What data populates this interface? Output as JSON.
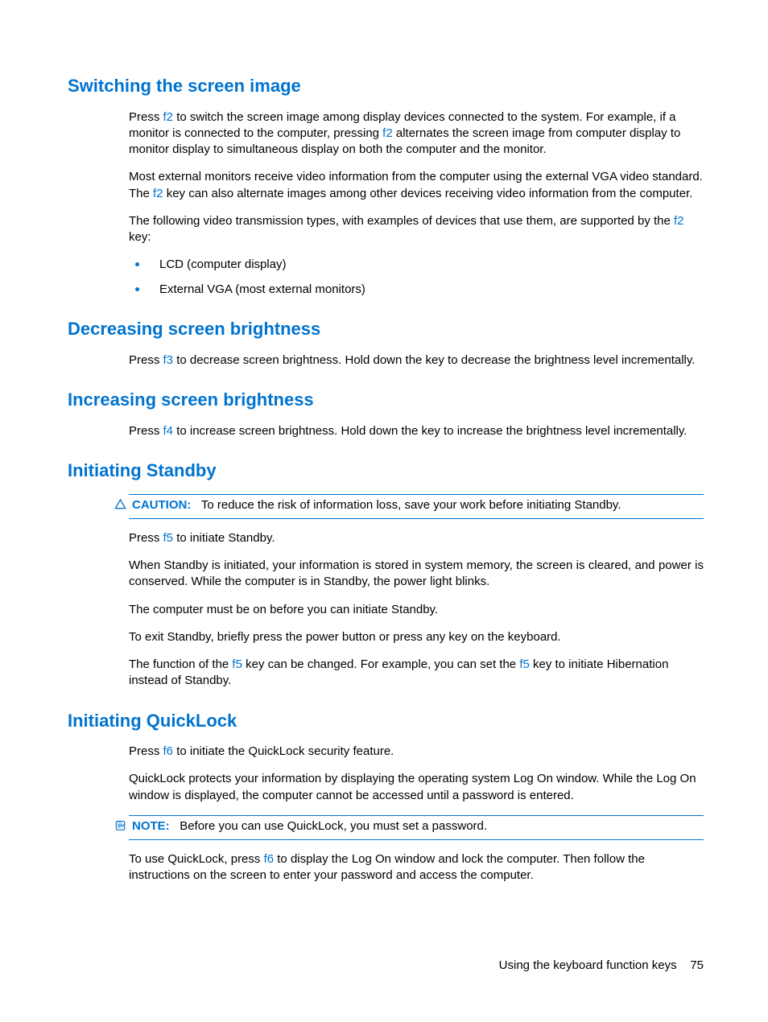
{
  "sections": {
    "s1": {
      "heading": "Switching the screen image",
      "p1a": "Press ",
      "p1key1": "f2",
      "p1b": " to switch the screen image among display devices connected to the system. For example, if a monitor is connected to the computer, pressing ",
      "p1key2": "f2",
      "p1c": " alternates the screen image from computer display to monitor display to simultaneous display on both the computer and the monitor.",
      "p2a": "Most external monitors receive video information from the computer using the external VGA video standard. The ",
      "p2key1": "f2",
      "p2b": " key can also alternate images among other devices receiving video information from the computer.",
      "p3a": "The following video transmission types, with examples of devices that use them, are supported by the ",
      "p3key1": "f2",
      "p3b": " key:",
      "li1": "LCD (computer display)",
      "li2": "External VGA (most external monitors)"
    },
    "s2": {
      "heading": "Decreasing screen brightness",
      "p1a": "Press ",
      "p1key1": "f3",
      "p1b": " to decrease screen brightness. Hold down the key to decrease the brightness level incrementally."
    },
    "s3": {
      "heading": "Increasing screen brightness",
      "p1a": "Press ",
      "p1key1": "f4",
      "p1b": " to increase screen brightness. Hold down the key to increase the brightness level incrementally."
    },
    "s4": {
      "heading": "Initiating Standby",
      "caution_label": "CAUTION:",
      "caution_text": "To reduce the risk of information loss, save your work before initiating Standby.",
      "p1a": "Press ",
      "p1key1": "f5",
      "p1b": " to initiate Standby.",
      "p2": "When Standby is initiated, your information is stored in system memory, the screen is cleared, and power is conserved. While the computer is in Standby, the power light blinks.",
      "p3": "The computer must be on before you can initiate Standby.",
      "p4": "To exit Standby, briefly press the power button or press any key on the keyboard.",
      "p5a": "The function of the ",
      "p5key1": "f5",
      "p5b": " key can be changed. For example, you can set the ",
      "p5key2": "f5",
      "p5c": " key to initiate Hibernation instead of Standby."
    },
    "s5": {
      "heading": "Initiating QuickLock",
      "p1a": "Press ",
      "p1key1": "f6",
      "p1b": " to initiate the QuickLock security feature.",
      "p2": "QuickLock protects your information by displaying the operating system Log On window. While the Log On window is displayed, the computer cannot be accessed until a password is entered.",
      "note_label": "NOTE:",
      "note_text": "Before you can use QuickLock, you must set a password.",
      "p3a": "To use QuickLock, press ",
      "p3key1": "f6",
      "p3b": " to display the Log On window and lock the computer. Then follow the instructions on the screen to enter your password and access the computer."
    }
  },
  "footer": {
    "text": "Using the keyboard function keys",
    "page_number": "75"
  }
}
